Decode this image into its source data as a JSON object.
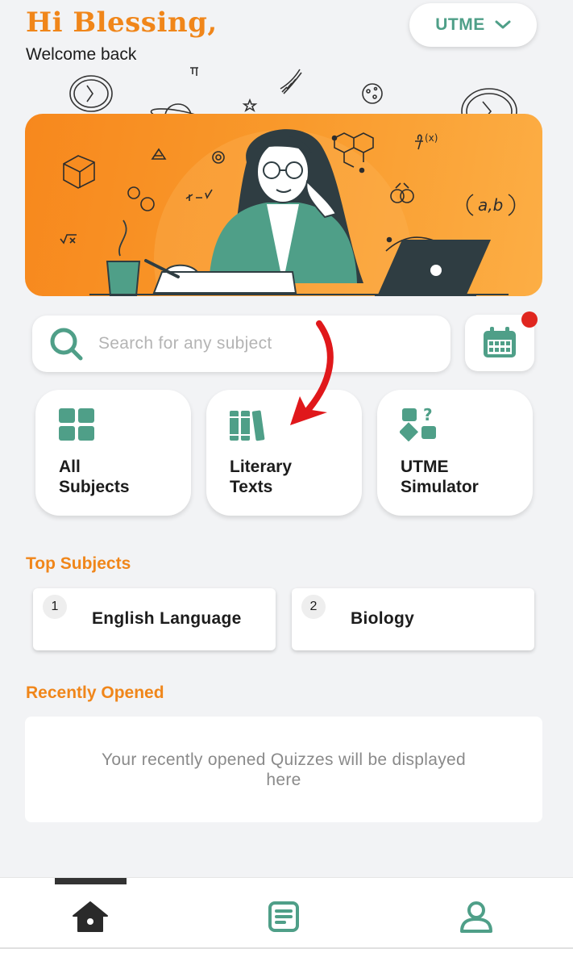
{
  "header": {
    "greeting": "Hi Blessing,",
    "subtitle": "Welcome back",
    "exam_selector": {
      "label": "UTME",
      "icon": "chevron-down-icon"
    }
  },
  "search": {
    "placeholder": "Search for any subject",
    "icon": "search-icon",
    "calendar_icon": "calendar-icon",
    "has_notification": true
  },
  "quick_actions": [
    {
      "label": "All\nSubjects",
      "icon": "grid-icon"
    },
    {
      "label": "Literary\nTexts",
      "icon": "books-icon"
    },
    {
      "label": "UTME\nSimulator",
      "icon": "shapes-question-icon"
    }
  ],
  "top_subjects": {
    "title": "Top Subjects",
    "items": [
      {
        "rank": "1",
        "name": "English Language"
      },
      {
        "rank": "2",
        "name": "Biology"
      }
    ]
  },
  "recently_opened": {
    "title": "Recently Opened",
    "empty_message": "Your recently opened Quizzes will be displayed here"
  },
  "bottom_nav": [
    {
      "icon": "home-icon",
      "active": true
    },
    {
      "icon": "notes-icon",
      "active": false
    },
    {
      "icon": "profile-icon",
      "active": false
    }
  ],
  "colors": {
    "accent_orange": "#f0861a",
    "accent_teal": "#4f9f88",
    "notification_red": "#e0261f",
    "annotation_arrow": "#e0181b"
  }
}
